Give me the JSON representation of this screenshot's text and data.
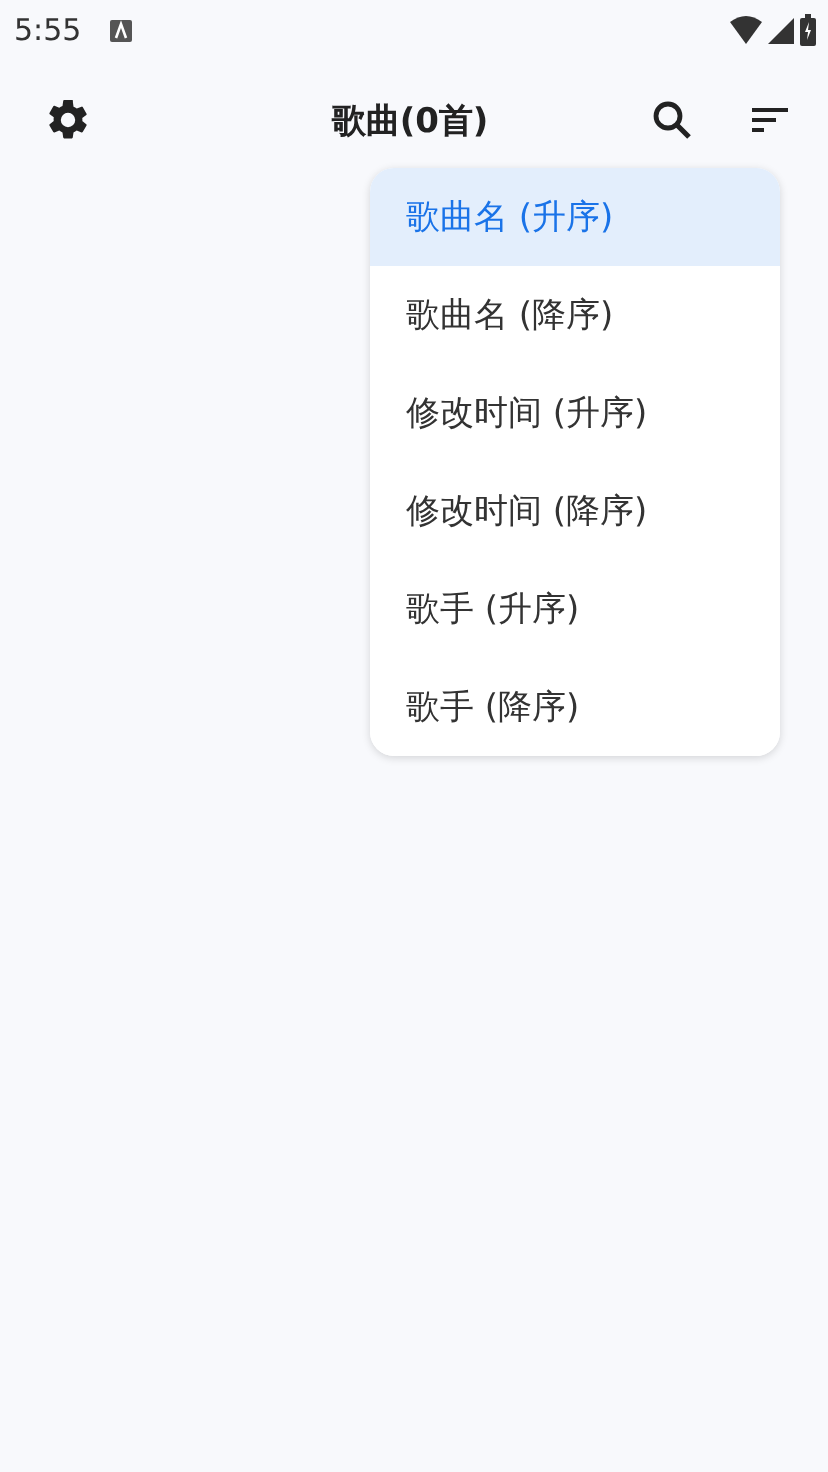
{
  "status_bar": {
    "time": "5:55"
  },
  "app_bar": {
    "title": "歌曲(0首)"
  },
  "sort_menu": {
    "items": [
      {
        "label": "歌曲名 (升序)",
        "selected": true
      },
      {
        "label": "歌曲名 (降序)",
        "selected": false
      },
      {
        "label": "修改时间 (升序)",
        "selected": false
      },
      {
        "label": "修改时间 (降序)",
        "selected": false
      },
      {
        "label": "歌手 (升序)",
        "selected": false
      },
      {
        "label": "歌手 (降序)",
        "selected": false
      }
    ]
  }
}
